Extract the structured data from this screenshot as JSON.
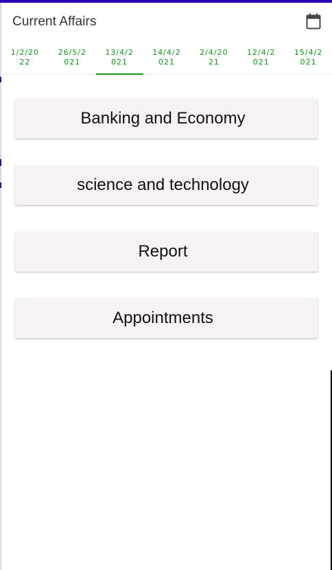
{
  "app_bar": {
    "title": "Current Affairs",
    "calendar_icon": "calendar-icon"
  },
  "tabs": [
    {
      "label": "1/2/2022",
      "active": false
    },
    {
      "label": "26/5/2021",
      "active": false
    },
    {
      "label": "13/4/2021",
      "active": true
    },
    {
      "label": "14/4/2021",
      "active": false
    },
    {
      "label": "2/4/2021",
      "active": false
    },
    {
      "label": "12/4/2021",
      "active": false
    },
    {
      "label": "15/4/2021",
      "active": false
    }
  ],
  "categories": [
    {
      "label": "Banking and Economy"
    },
    {
      "label": "science and technology"
    },
    {
      "label": "Report"
    },
    {
      "label": "Appointments"
    }
  ],
  "colors": {
    "accent_green": "#12921a",
    "top_strip": "#2a00b7",
    "card_bg": "#f6f3f2"
  }
}
